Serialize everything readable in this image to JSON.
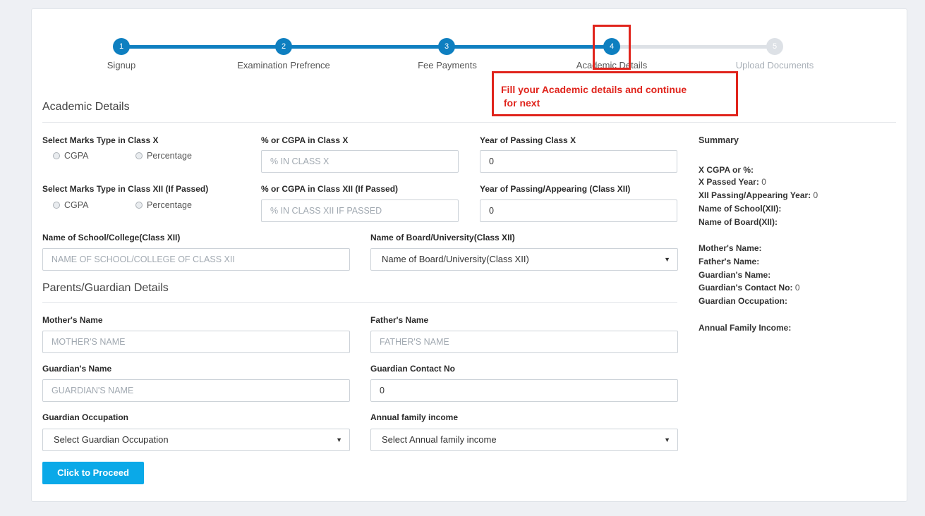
{
  "stepper": {
    "steps": [
      {
        "num": "1",
        "label": "Signup"
      },
      {
        "num": "2",
        "label": "Examination Prefrence"
      },
      {
        "num": "3",
        "label": "Fee Payments"
      },
      {
        "num": "4",
        "label": "Academic Details"
      },
      {
        "num": "5",
        "label": "Upload Documents"
      }
    ],
    "current_step": 4
  },
  "annotation": {
    "line1": "Fill your Academic details and continue",
    "line2": " for next",
    "color": "#e0241c"
  },
  "academic": {
    "title": "Academic Details",
    "class_x_type_label": "Select Marks Type in Class X",
    "class_x_cgpa": "CGPA",
    "class_x_percentage": "Percentage",
    "class_x_score_label": "% or CGPA in Class X",
    "class_x_score_placeholder": "% IN CLASS X",
    "class_x_year_label": "Year of Passing Class X",
    "class_x_year_value": "0",
    "class_xii_type_label": "Select Marks Type in Class XII (If Passed)",
    "class_xii_cgpa": "CGPA",
    "class_xii_percentage": "Percentage",
    "class_xii_score_label": "% or CGPA in Class XII (If Passed)",
    "class_xii_score_placeholder": "% IN CLASS XII IF PASSED",
    "class_xii_year_label": "Year of Passing/Appearing (Class XII)",
    "class_xii_year_value": "0",
    "school_label": "Name of School/College(Class XII)",
    "school_placeholder": "NAME OF SCHOOL/COLLEGE OF CLASS XII",
    "board_label": "Name of Board/University(Class XII)",
    "board_selected": "Name of Board/University(Class XII)"
  },
  "parents": {
    "title": "Parents/Guardian Details",
    "mother_label": "Mother's Name",
    "mother_placeholder": "MOTHER'S NAME",
    "father_label": "Father's Name",
    "father_placeholder": "FATHER'S NAME",
    "guardian_label": "Guardian's Name",
    "guardian_placeholder": "GUARDIAN'S NAME",
    "contact_label": "Guardian Contact No",
    "contact_value": "0",
    "occupation_label": "Guardian Occupation",
    "occupation_selected": "Select Guardian Occupation",
    "income_label": "Annual family income",
    "income_selected": "Select Annual family income"
  },
  "proceed_button": "Click to Proceed",
  "summary": {
    "title": "Summary",
    "x_score": "X CGPA or %:",
    "x_year": "X Passed Year:",
    "x_year_value": "0",
    "xii_year": "XII Passing/Appearing Year:",
    "xii_year_value": "0",
    "school": "Name of School(XII):",
    "board": "Name of Board(XII):",
    "mother": "Mother's Name:",
    "father": "Father's Name:",
    "guardian": "Guardian's Name:",
    "contact": "Guardian's Contact No:",
    "contact_value": "0",
    "occupation": "Guardian Occupation:",
    "income": "Annual Family Income:"
  },
  "colors": {
    "progress": "#0e7fc0",
    "pending": "#dde1e6",
    "button": "#0aa9e8"
  }
}
